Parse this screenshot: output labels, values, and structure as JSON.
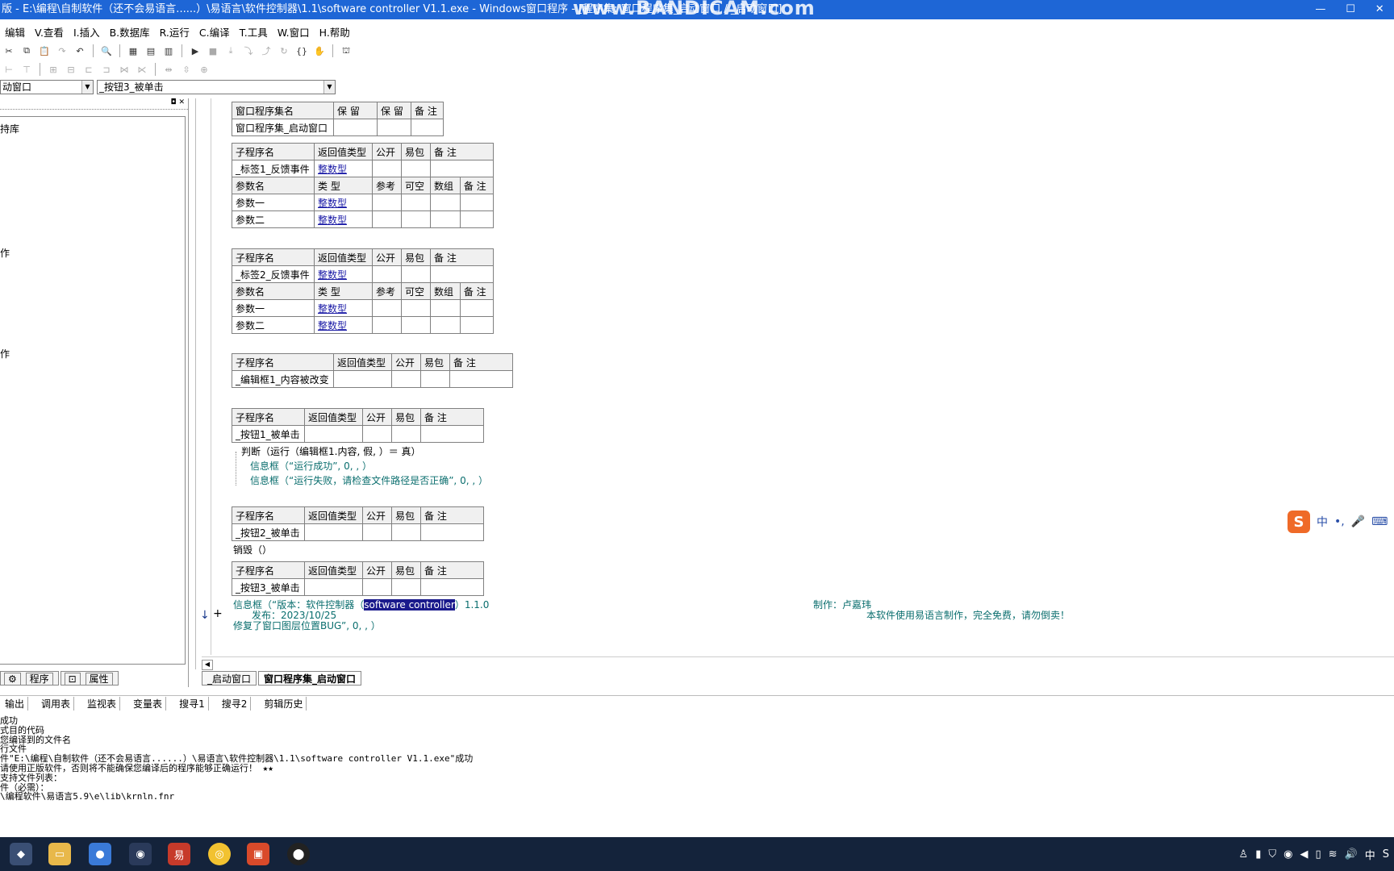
{
  "window": {
    "title": "版 - E:\\编程\\自制软件（还不会易语言......）\\易语言\\软件控制器\\1.1\\software controller V1.1.exe - Windows窗口程序 - [程序集: 窗口程序集_启动窗口 / _启动窗口]",
    "watermark": "www.BANDICAM.com",
    "controls": [
      "—",
      "☐",
      "✕"
    ]
  },
  "menu": [
    "编辑",
    "V.查看",
    "I.插入",
    "B.数据库",
    "R.运行",
    "C.编译",
    "T.工具",
    "W.窗口",
    "H.帮助"
  ],
  "combos": {
    "object": "动窗口",
    "event": "_按钮3_被单击"
  },
  "left_panel": {
    "tree_items": [
      "持库",
      "作",
      "作"
    ],
    "tabs": [
      "程序",
      "属性"
    ]
  },
  "editor": {
    "class_table": {
      "headers": [
        "窗口程序集名",
        "保 留",
        "保 留",
        "备 注"
      ],
      "row": [
        "窗口程序集_启动窗口",
        "",
        "",
        ""
      ]
    },
    "sub1": {
      "headers": [
        "子程序名",
        "返回值类型",
        "公开",
        "易包",
        "备 注"
      ],
      "row": [
        "_标签1_反馈事件",
        "整数型",
        "",
        "",
        ""
      ],
      "param_headers": [
        "参数名",
        "类 型",
        "参考",
        "可空",
        "数组",
        "备 注"
      ],
      "params": [
        [
          "参数一",
          "整数型"
        ],
        [
          "参数二",
          "整数型"
        ]
      ]
    },
    "sub2": {
      "headers": [
        "子程序名",
        "返回值类型",
        "公开",
        "易包",
        "备 注"
      ],
      "row": [
        "_标签2_反馈事件",
        "整数型",
        "",
        "",
        ""
      ],
      "param_headers": [
        "参数名",
        "类 型",
        "参考",
        "可空",
        "数组",
        "备 注"
      ],
      "params": [
        [
          "参数一",
          "整数型"
        ],
        [
          "参数二",
          "整数型"
        ]
      ]
    },
    "sub3": {
      "headers": [
        "子程序名",
        "返回值类型",
        "公开",
        "易包",
        "备 注"
      ],
      "row": [
        "_编辑框1_内容被改变",
        "",
        "",
        "",
        ""
      ]
    },
    "sub4": {
      "headers": [
        "子程序名",
        "返回值类型",
        "公开",
        "易包",
        "备 注"
      ],
      "row": [
        "_按钮1_被单击",
        "",
        "",
        "",
        ""
      ],
      "code": [
        "判断（运行（编辑框1.内容, 假, ）＝ 真）",
        "信息框（“运行成功”, 0, , ）",
        "信息框（“运行失败，请检查文件路径是否正确”, 0, , ）"
      ]
    },
    "sub5": {
      "headers": [
        "子程序名",
        "返回值类型",
        "公开",
        "易包",
        "备 注"
      ],
      "row": [
        "_按钮2_被单击",
        "",
        "",
        "",
        ""
      ],
      "code": "销毁（）"
    },
    "sub6": {
      "headers": [
        "子程序名",
        "返回值类型",
        "公开",
        "易包",
        "备 注"
      ],
      "row": [
        "_按钮3_被单击",
        "",
        "",
        "",
        ""
      ],
      "code_prefix": "信息框（“版本：软件控制器（",
      "code_selected": "software controller",
      "code_suffix": "）1.1.0",
      "code_author": "制作：卢嘉玮",
      "code_date": "发布：2023/10/25",
      "code_note": "本软件使用易语言制作，完全免费，请勿倒卖！",
      "code_last": "修复了窗口图层位置BUG”, 0, , ）"
    },
    "tabs": [
      "_启动窗口",
      "窗口程序集_启动窗口"
    ]
  },
  "output_tabs": [
    "输出",
    "调用表",
    "监视表",
    "变量表",
    "搜寻1",
    "搜寻2",
    "剪辑历史"
  ],
  "output_lines": [
    "成功",
    "式目的代码",
    "您编译到的文件名",
    "行文件",
    "件\"E:\\编程\\自制软件（还不会易语言......）\\易语言\\软件控制器\\1.1\\software controller V1.1.exe\"成功",
    "请使用正版软件，否则将不能确保您编译后的程序能够正确运行！ ★★",
    "",
    "支持文件列表：",
    "件（必需）：",
    "\\编程软件\\易语言5.9\\e\\lib\\krnln.fnr"
  ],
  "ime": {
    "lang": "中",
    "punct": "•,",
    "mic": "🎤",
    "kbd": "⌨"
  },
  "tray": [
    "♙",
    "▮",
    "⛉",
    "◉",
    "◀",
    "▯",
    "≋",
    "🔊",
    "中",
    "S"
  ]
}
